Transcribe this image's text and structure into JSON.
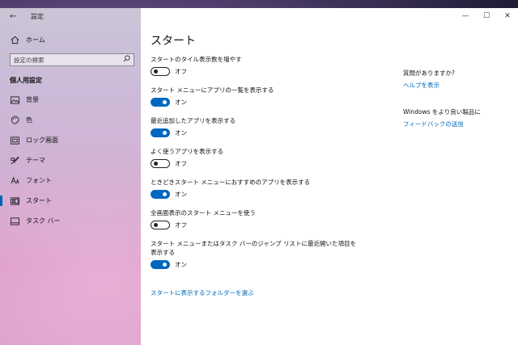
{
  "titlebar": {
    "app_title": "設定",
    "back_icon": "back-arrow-icon",
    "minimize_glyph": "—",
    "maximize_glyph": "☐",
    "close_glyph": "✕"
  },
  "sidebar": {
    "home_label": "ホーム",
    "search_placeholder": "設定の検索",
    "section_header": "個人用設定",
    "items": [
      {
        "label": "背景",
        "icon": "picture-icon"
      },
      {
        "label": "色",
        "icon": "palette-icon"
      },
      {
        "label": "ロック画面",
        "icon": "lock-screen-icon"
      },
      {
        "label": "テーマ",
        "icon": "theme-brush-icon"
      },
      {
        "label": "フォント",
        "icon": "font-icon"
      },
      {
        "label": "スタート",
        "icon": "start-grid-icon",
        "active": true
      },
      {
        "label": "タスク バー",
        "icon": "taskbar-icon"
      }
    ]
  },
  "main": {
    "title": "スタート",
    "settings": [
      {
        "label": "スタートのタイル表示数を増やす",
        "state": "オフ",
        "on": false
      },
      {
        "label": "スタート メニューにアプリの一覧を表示する",
        "state": "オン",
        "on": true
      },
      {
        "label": "最近追加したアプリを表示する",
        "state": "オン",
        "on": true
      },
      {
        "label": "よく使うアプリを表示する",
        "state": "オフ",
        "on": false
      },
      {
        "label": "ときどきスタート メニューにおすすめのアプリを表示する",
        "state": "オン",
        "on": true
      },
      {
        "label": "全画面表示のスタート メニューを使う",
        "state": "オフ",
        "on": false
      },
      {
        "label": "スタート メニューまたはタスク バーのジャンプ リストに最近開いた項目を表示する",
        "state": "オン",
        "on": true
      }
    ],
    "folder_link": "スタートに表示するフォルダーを選ぶ"
  },
  "aside": {
    "question_title": "質問がありますか?",
    "help_link": "ヘルプを表示",
    "feedback_title": "Windows をより良い製品に",
    "feedback_link": "フィードバックの送信"
  },
  "colors": {
    "accent": "#0067c0",
    "link": "#0067b8"
  }
}
